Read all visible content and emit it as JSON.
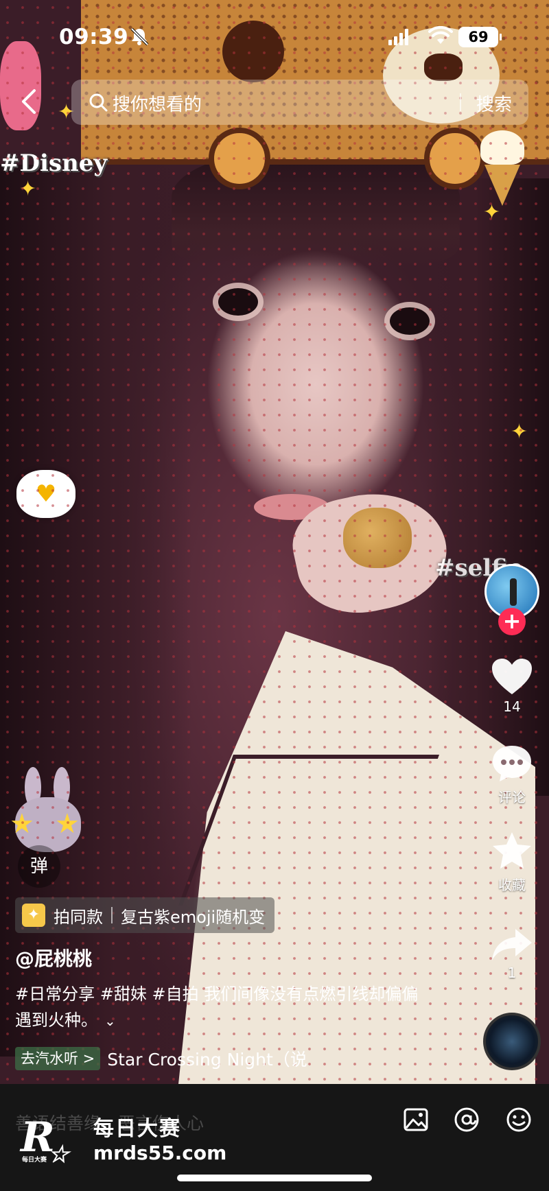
{
  "status_bar": {
    "time": "09:39",
    "battery": "69"
  },
  "search": {
    "placeholder": "搜你想看的",
    "button": "搜索"
  },
  "stickers": {
    "disney": "#Disney",
    "selfie": "#selfie"
  },
  "actions": {
    "likes": "14",
    "comments": "评论",
    "favorites": "收藏",
    "shares": "1"
  },
  "danmaku": {
    "label": "弹"
  },
  "effect": {
    "label": "拍同款",
    "name": "复古紫emoji随机变"
  },
  "author": "@屁桃桃",
  "description": "#日常分享 #甜妹 #自拍 我们间像没有点燃引线却偏偏遇到火种。",
  "music": {
    "chip": "去汽水听 >",
    "song": "Star Crossing Night（说"
  },
  "comment_bar": {
    "placeholder": "善语结善缘，恶言伤人心"
  },
  "watermark": {
    "logo": "R",
    "logo_small": "每日大赛",
    "title": "每日大赛",
    "url": "mrds55.com"
  },
  "colors": {
    "accent": "#fe2c55",
    "chip_green": "#3c6e46",
    "effect_yellow": "#f6c84a",
    "comment_bar_bg": "#161616"
  },
  "icons": [
    "bell-muted-icon",
    "signal-icon",
    "wifi-icon",
    "back-icon",
    "search-icon",
    "heart-icon",
    "comment-icon",
    "star-icon",
    "share-icon",
    "image-icon",
    "at-icon",
    "emoji-icon",
    "chevron-down-icon"
  ]
}
